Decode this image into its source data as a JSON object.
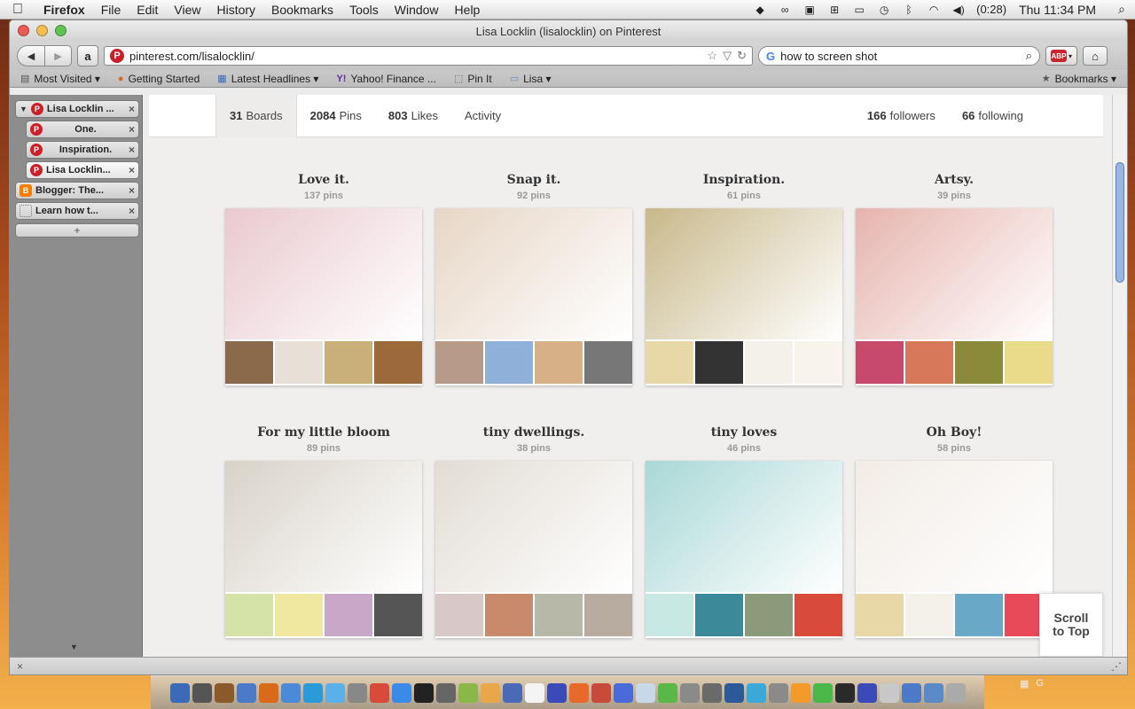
{
  "menubar": {
    "app": "Firefox",
    "items": [
      "File",
      "Edit",
      "View",
      "History",
      "Bookmarks",
      "Tools",
      "Window",
      "Help"
    ],
    "battery": "(0:28)",
    "clock": "Thu 11:34 PM"
  },
  "window": {
    "title": "Lisa Locklin (lisalocklin) on Pinterest"
  },
  "navbar": {
    "url": "pinterest.com/lisalocklin/",
    "search_value": "how to screen shot",
    "abp_label": "ABP"
  },
  "bookmarks": [
    {
      "label": "Most Visited ▾",
      "icon": "folder-icon"
    },
    {
      "label": "Getting Started",
      "icon": "firefox-icon"
    },
    {
      "label": "Latest Headlines ▾",
      "icon": "rss-icon"
    },
    {
      "label": "Yahoo! Finance ...",
      "icon": "yahoo-icon"
    },
    {
      "label": "Pin It",
      "icon": "blank-icon"
    },
    {
      "label": "Lisa ▾",
      "icon": "folder-icon"
    },
    {
      "label": "Bookmarks ▾",
      "icon": "bookmarks-icon"
    }
  ],
  "tabs": [
    {
      "label": "Lisa Locklin ...",
      "type": "group",
      "icon": "pinterest"
    },
    {
      "label": "One.",
      "type": "child",
      "icon": "pinterest"
    },
    {
      "label": "Inspiration.",
      "type": "child",
      "icon": "pinterest"
    },
    {
      "label": "Lisa Locklin...",
      "type": "child",
      "icon": "pinterest"
    },
    {
      "label": "Blogger: The...",
      "type": "top",
      "icon": "blogger"
    },
    {
      "label": "Learn how t...",
      "type": "top",
      "icon": "blank"
    }
  ],
  "profile_nav": {
    "boards": {
      "count": "31",
      "label": "Boards"
    },
    "pins": {
      "count": "2084",
      "label": "Pins"
    },
    "likes": {
      "count": "803",
      "label": "Likes"
    },
    "activity": "Activity",
    "followers": {
      "count": "166",
      "label": "followers"
    },
    "following": {
      "count": "66",
      "label": "following"
    }
  },
  "boards": [
    {
      "title": "Love it.",
      "count": "137 pins",
      "cover": "#e9c9cf",
      "thumbs": [
        "#8a6a4a",
        "#e8e0d6",
        "#c9b07a",
        "#9c6a3a"
      ]
    },
    {
      "title": "Snap it.",
      "count": "92 pins",
      "cover": "#e7d6c6",
      "thumbs": [
        "#b89a88",
        "#8fb0d8",
        "#d8b088",
        "#777777"
      ]
    },
    {
      "title": "Inspiration.",
      "count": "61 pins",
      "cover": "#c8b88a",
      "thumbs": [
        "#e8d8a8",
        "#333333",
        "#f4f0ea",
        "#f8f4ec"
      ]
    },
    {
      "title": "Artsy.",
      "count": "39 pins",
      "cover": "#e6b4ae",
      "thumbs": [
        "#c84a6a",
        "#d8785a",
        "#8a8a3a",
        "#e8dc8a"
      ]
    },
    {
      "title": "For my little bloom",
      "count": "89 pins",
      "cover": "#d8d2c8",
      "thumbs": [
        "#d6e3a8",
        "#f0e8a0",
        "#c8a8c8",
        "#555555"
      ]
    },
    {
      "title": "tiny dwellings.",
      "count": "38 pins",
      "cover": "#e2dcd4",
      "thumbs": [
        "#d8c8c8",
        "#c88a6a",
        "#b8b8a8",
        "#b8aca0"
      ]
    },
    {
      "title": "tiny loves",
      "count": "46 pins",
      "cover": "#a8d8d6",
      "thumbs": [
        "#c8e8e4",
        "#3a8a9a",
        "#8a9a7a",
        "#d84a3a"
      ]
    },
    {
      "title": "Oh Boy!",
      "count": "58 pins",
      "cover": "#f2ece6",
      "thumbs": [
        "#e8d8a8",
        "#f4f0ea",
        "#6aa8c8",
        "#e84a5a"
      ]
    }
  ],
  "scroll_top": {
    "line1": "Scroll",
    "line2": "to Top"
  },
  "status": {
    "left": "×",
    "right": ""
  }
}
